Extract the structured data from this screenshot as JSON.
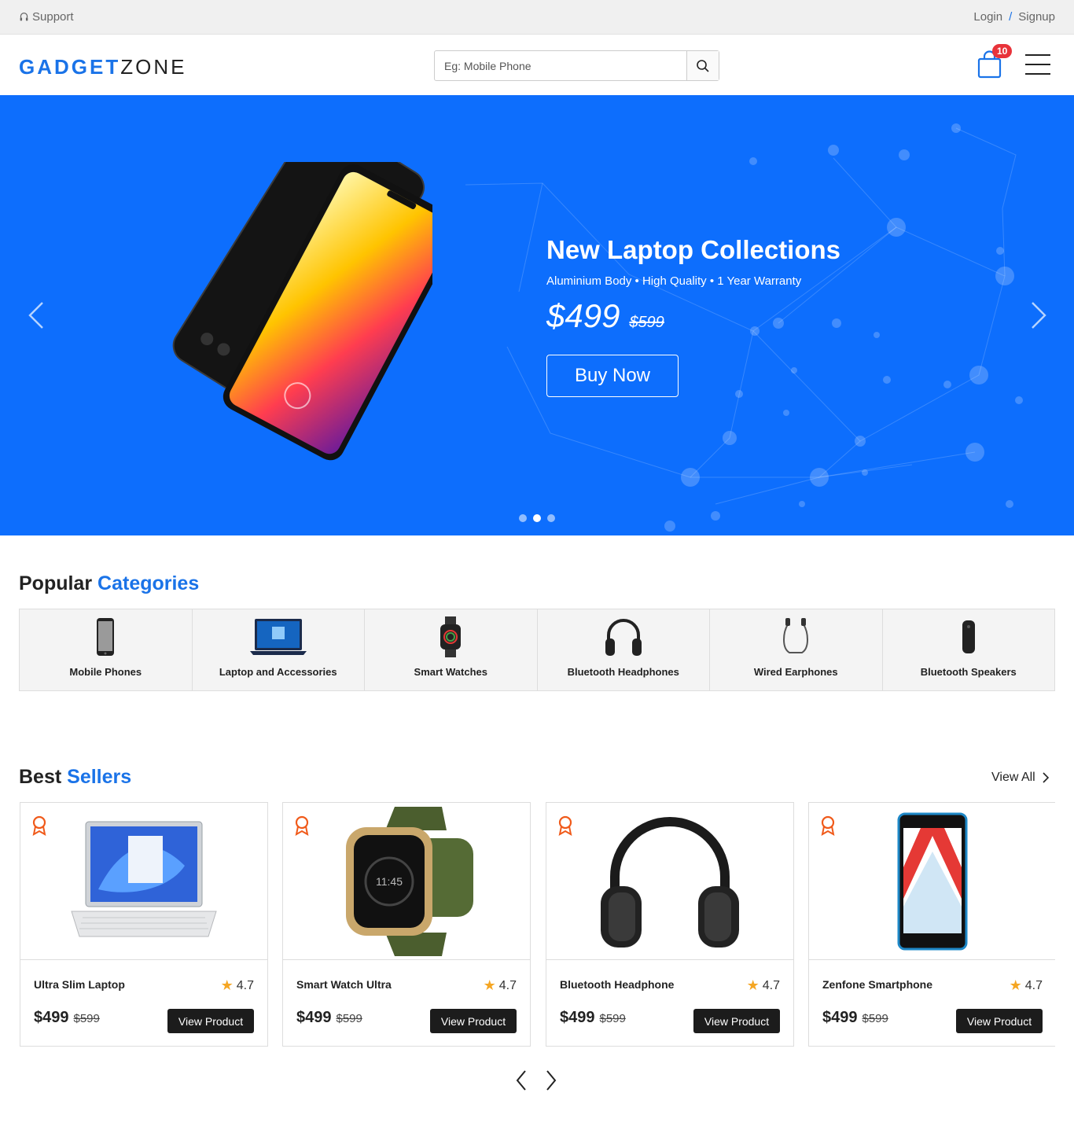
{
  "topbar": {
    "support": "Support",
    "login": "Login",
    "separator": "/",
    "signup": "Signup"
  },
  "header": {
    "logo_bold": "GADGET",
    "logo_light": "ZONE",
    "search_placeholder": "Eg: Mobile Phone",
    "cart_count": "10"
  },
  "hero": {
    "title": "New Laptop Collections",
    "subtitle": "Aluminium Body • High Quality • 1 Year Warranty",
    "price": "$499",
    "old_price": "$599",
    "cta": "Buy Now",
    "slide_count": 3,
    "active_slide": 2,
    "bg_color": "#0d6efd"
  },
  "categories": {
    "title_a": "Popular",
    "title_b": "Categories",
    "items": [
      {
        "label": "Mobile Phones",
        "icon": "phone-icon"
      },
      {
        "label": "Laptop and Accessories",
        "icon": "laptop-icon"
      },
      {
        "label": "Smart Watches",
        "icon": "watch-icon"
      },
      {
        "label": "Bluetooth Headphones",
        "icon": "headphones-icon"
      },
      {
        "label": "Wired Earphones",
        "icon": "earphones-icon"
      },
      {
        "label": "Bluetooth Speakers",
        "icon": "speaker-icon"
      }
    ]
  },
  "bestsellers": {
    "title_a": "Best",
    "title_b": "Sellers",
    "view_all": "View All",
    "products": [
      {
        "name": "Ultra Slim Laptop",
        "rating": "4.7",
        "price": "$499",
        "old_price": "$599",
        "button": "View Product"
      },
      {
        "name": "Smart Watch Ultra",
        "rating": "4.7",
        "price": "$499",
        "old_price": "$599",
        "button": "View Product"
      },
      {
        "name": "Bluetooth Headphone",
        "rating": "4.7",
        "price": "$499",
        "old_price": "$599",
        "button": "View Product"
      },
      {
        "name": "Zenfone Smartphone",
        "rating": "4.7",
        "price": "$499",
        "old_price": "$599",
        "button": "View Product"
      }
    ]
  },
  "colors": {
    "accent": "#1a73e8",
    "badge": "#e8333a",
    "dark_button": "#1c1c1c",
    "medal": "#f05a1a",
    "star": "#f5a623"
  }
}
